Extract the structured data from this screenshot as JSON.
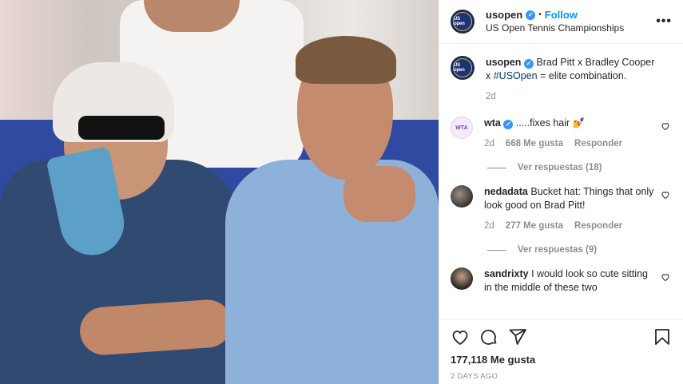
{
  "header": {
    "username": "usopen",
    "follow_label": "Follow",
    "separator": "•",
    "subtitle": "US Open Tennis Championships",
    "more_label": "•••",
    "avatar_text": "US open"
  },
  "caption": {
    "username": "usopen",
    "text_before": "Brad Pitt x Bradley Cooper x ",
    "hashtag": "#USOpen",
    "text_after": " = elite combination.",
    "time": "2d"
  },
  "comments": [
    {
      "username": "wta",
      "verified": true,
      "text": ".....fixes hair 💅",
      "time": "2d",
      "likes": "668 Me gusta",
      "reply_label": "Responder",
      "view_replies": "Ver respuestas (18)",
      "avatar_text": "WTA"
    },
    {
      "username": "nedadata",
      "verified": false,
      "text": "Bucket hat: Things that only look good on Brad Pitt!",
      "time": "2d",
      "likes": "277 Me gusta",
      "reply_label": "Responder",
      "view_replies": "Ver respuestas (9)"
    },
    {
      "username": "sandrixty",
      "verified": false,
      "text": "I would look so cute sitting in the middle of these two"
    }
  ],
  "actions": {
    "likes_label": "177,118 Me gusta",
    "time_ago": "2 DAYS AGO"
  },
  "icons": [
    "heart-icon",
    "comment-icon",
    "share-icon",
    "bookmark-icon",
    "more-icon",
    "verified-icon"
  ],
  "colors": {
    "follow": "#0095f6",
    "verified": "#3897f0",
    "meta": "#8e8e8e",
    "hashtag": "#00376b"
  }
}
